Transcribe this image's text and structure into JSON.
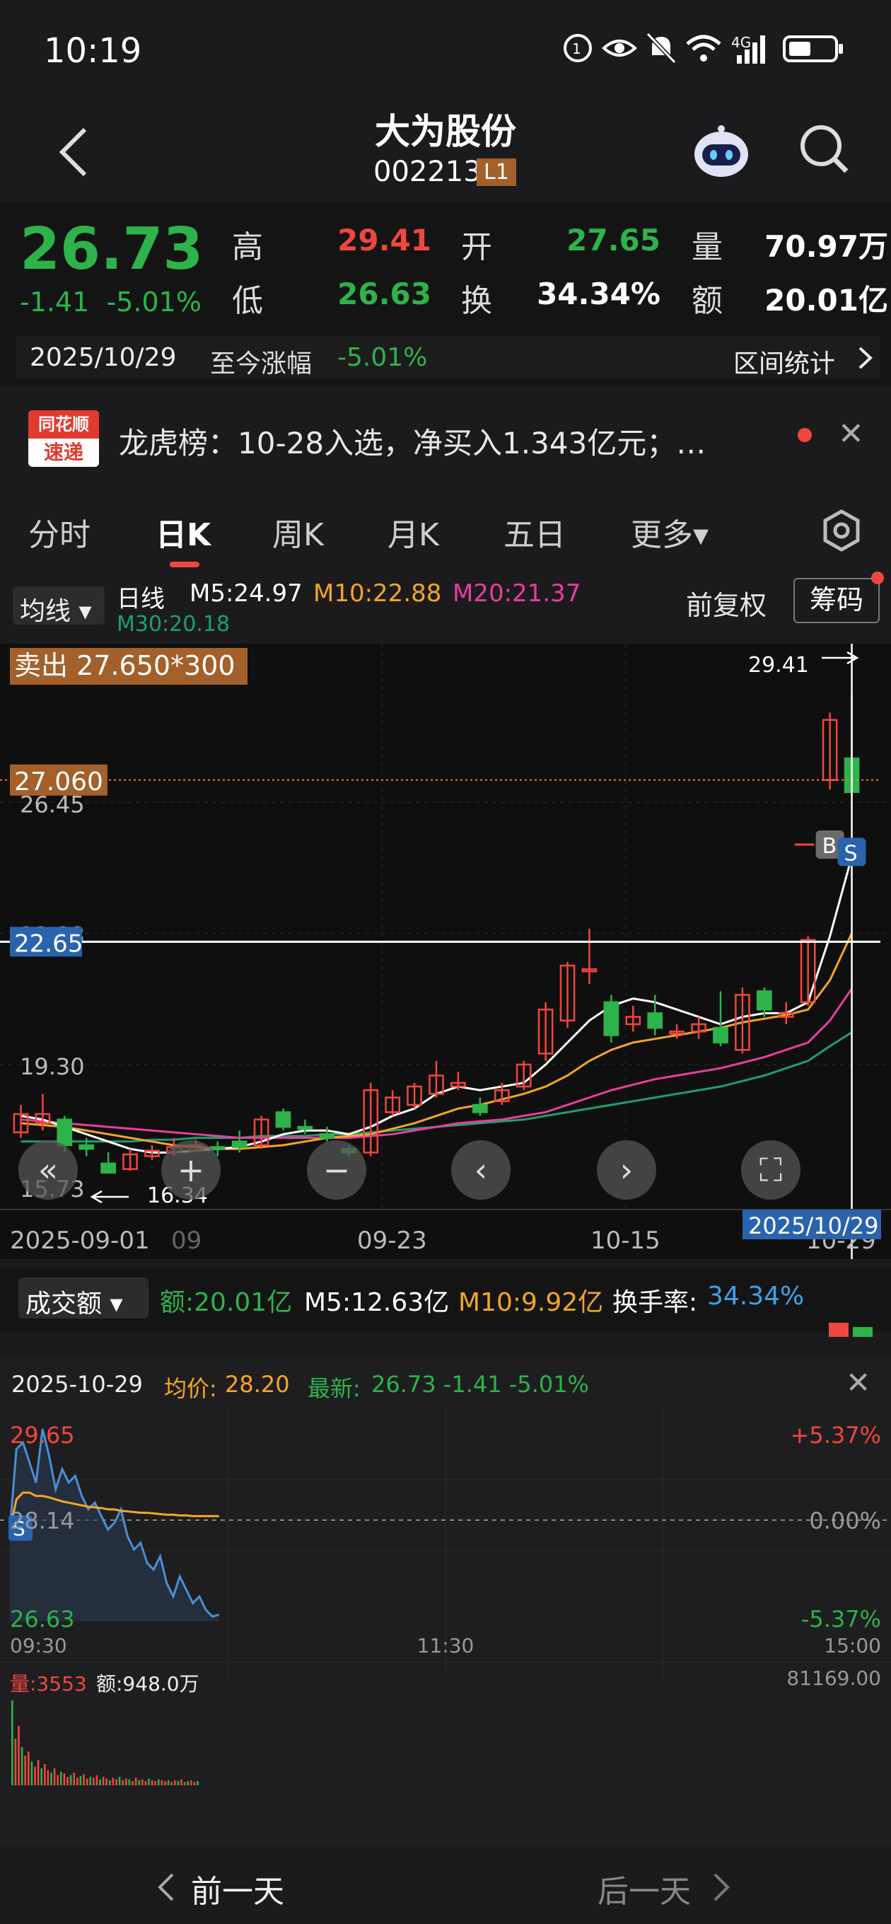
{
  "status": {
    "time": "10:19",
    "network": "4G"
  },
  "header": {
    "title": "大为股份",
    "code": "002213",
    "level": "L1"
  },
  "quote": {
    "price": "26.73",
    "change": "-1.41",
    "change_pct": "-5.01%",
    "high_label": "高",
    "high": "29.41",
    "low_label": "低",
    "low": "26.63",
    "open_label": "开",
    "open": "27.65",
    "turnover_label": "换",
    "turnover": "34.34%",
    "volume_label": "量",
    "volume": "70.97万",
    "amount_label": "额",
    "amount": "20.01亿",
    "date": "2025/10/29",
    "since_label": "至今涨幅",
    "since_value": "-5.01%",
    "stat_label": "区间统计"
  },
  "news": {
    "logo_top": "同花顺",
    "logo_bottom": "速递",
    "text": "龙虎榜：10-28入选，净买入1.343亿元；…",
    "close": "✕"
  },
  "tabs": [
    {
      "label": "分时"
    },
    {
      "label": "日K"
    },
    {
      "label": "周K"
    },
    {
      "label": "月K"
    },
    {
      "label": "五日"
    },
    {
      "label": "更多▾"
    }
  ],
  "ma_row": {
    "selector": "均线 ▾",
    "period": "日线",
    "m5": "M5:24.97",
    "m10": "M10:22.88",
    "m20": "M20:21.37",
    "m30": "M30:20.18",
    "adjust": "前复权",
    "chip": "筹码"
  },
  "kchart": {
    "sell_tag": "卖出 27.650*300",
    "price_tag_1": "27.060",
    "price_tag_2": "22.65",
    "level_1": "26.45",
    "level_2": "22.88",
    "level_3": "19.30",
    "level_4": "15.73",
    "high_mark": "29.41",
    "low_mark": "16.34",
    "x_labels": [
      "2025-09-01",
      "09",
      "09-23",
      "10-15",
      "10-29"
    ],
    "cursor_date": "2025/10/29",
    "b_marker": "B",
    "s_marker": "S",
    "colors": {
      "up": "#f0473d",
      "down": "#2db34a",
      "m5": "#ffffff",
      "m10": "#f5a623",
      "m20": "#e83e9e",
      "m30": "#1f9e6e"
    }
  },
  "chart_data": {
    "type": "candlestick",
    "ylim": [
      15.73,
      30.2
    ],
    "candles": [
      {
        "o": 17.45,
        "c": 17.95,
        "h": 18.2,
        "l": 17.3
      },
      {
        "o": 17.7,
        "c": 17.95,
        "h": 18.5,
        "l": 17.5
      },
      {
        "o": 17.8,
        "c": 17.1,
        "h": 17.9,
        "l": 16.9
      },
      {
        "o": 17.1,
        "c": 17.0,
        "h": 17.3,
        "l": 16.8
      },
      {
        "o": 16.6,
        "c": 16.35,
        "h": 16.9,
        "l": 16.34
      },
      {
        "o": 16.45,
        "c": 16.85,
        "h": 17.0,
        "l": 16.4
      },
      {
        "o": 16.8,
        "c": 16.95,
        "h": 17.1,
        "l": 16.7
      },
      {
        "o": 16.9,
        "c": 17.05,
        "h": 17.3,
        "l": 16.8
      },
      {
        "o": 16.95,
        "c": 17.1,
        "h": 17.25,
        "l": 16.9
      },
      {
        "o": 17.05,
        "c": 17.0,
        "h": 17.2,
        "l": 16.8
      },
      {
        "o": 17.2,
        "c": 17.05,
        "h": 17.5,
        "l": 16.9
      },
      {
        "o": 17.1,
        "c": 17.8,
        "h": 17.9,
        "l": 17.0
      },
      {
        "o": 18.0,
        "c": 17.6,
        "h": 18.1,
        "l": 17.5
      },
      {
        "o": 17.6,
        "c": 17.55,
        "h": 17.8,
        "l": 17.4
      },
      {
        "o": 17.4,
        "c": 17.3,
        "h": 17.6,
        "l": 17.2
      },
      {
        "o": 17.0,
        "c": 16.9,
        "h": 17.1,
        "l": 16.8
      },
      {
        "o": 16.9,
        "c": 18.6,
        "h": 18.8,
        "l": 16.8
      },
      {
        "o": 18.0,
        "c": 18.4,
        "h": 18.6,
        "l": 17.9
      },
      {
        "o": 18.2,
        "c": 18.7,
        "h": 18.8,
        "l": 18.1
      },
      {
        "o": 18.5,
        "c": 19.0,
        "h": 19.4,
        "l": 18.4
      },
      {
        "o": 18.7,
        "c": 18.8,
        "h": 19.1,
        "l": 18.6
      },
      {
        "o": 18.2,
        "c": 18.0,
        "h": 18.4,
        "l": 17.9
      },
      {
        "o": 18.3,
        "c": 18.6,
        "h": 18.8,
        "l": 18.2
      },
      {
        "o": 18.7,
        "c": 19.3,
        "h": 19.4,
        "l": 18.6
      },
      {
        "o": 19.6,
        "c": 20.8,
        "h": 21.0,
        "l": 19.4
      },
      {
        "o": 20.5,
        "c": 22.0,
        "h": 22.1,
        "l": 20.3
      },
      {
        "o": 21.9,
        "c": 21.9,
        "h": 23.0,
        "l": 21.5
      },
      {
        "o": 21.0,
        "c": 20.1,
        "h": 21.2,
        "l": 19.9
      },
      {
        "o": 20.4,
        "c": 20.6,
        "h": 20.9,
        "l": 20.2
      },
      {
        "o": 20.7,
        "c": 20.3,
        "h": 21.2,
        "l": 20.1
      },
      {
        "o": 20.2,
        "c": 20.2,
        "h": 20.4,
        "l": 20.0
      },
      {
        "o": 20.2,
        "c": 20.4,
        "h": 20.6,
        "l": 20.0
      },
      {
        "o": 20.3,
        "c": 19.9,
        "h": 21.3,
        "l": 19.8
      },
      {
        "o": 19.7,
        "c": 21.2,
        "h": 21.4,
        "l": 19.6
      },
      {
        "o": 21.3,
        "c": 20.8,
        "h": 21.4,
        "l": 20.6
      },
      {
        "o": 20.6,
        "c": 20.7,
        "h": 21.0,
        "l": 20.4
      },
      {
        "o": 21.0,
        "c": 22.7,
        "h": 22.8,
        "l": 20.9
      },
      {
        "o": 27.06,
        "c": 28.7,
        "h": 28.9,
        "l": 26.8
      },
      {
        "o": 27.65,
        "c": 26.73,
        "h": 29.41,
        "l": 26.63
      }
    ],
    "ma5": [
      17.9,
      17.8,
      17.6,
      17.4,
      17.2,
      17.0,
      16.9,
      16.9,
      16.95,
      17.0,
      17.05,
      17.2,
      17.4,
      17.5,
      17.5,
      17.4,
      17.6,
      17.9,
      18.1,
      18.5,
      18.7,
      18.6,
      18.7,
      18.8,
      19.3,
      19.9,
      20.5,
      20.9,
      21.1,
      21.0,
      20.8,
      20.6,
      20.4,
      20.6,
      20.7,
      20.7,
      21.0,
      22.8,
      24.97
    ],
    "ma10": [
      17.7,
      17.65,
      17.6,
      17.5,
      17.4,
      17.3,
      17.2,
      17.1,
      17.05,
      17.0,
      17.0,
      17.05,
      17.1,
      17.2,
      17.3,
      17.35,
      17.4,
      17.55,
      17.7,
      17.9,
      18.1,
      18.2,
      18.35,
      18.5,
      18.7,
      19.0,
      19.4,
      19.7,
      19.9,
      20.0,
      20.1,
      20.2,
      20.3,
      20.45,
      20.55,
      20.65,
      20.8,
      21.6,
      22.88
    ],
    "ma20": [
      17.8,
      17.75,
      17.7,
      17.65,
      17.6,
      17.55,
      17.5,
      17.45,
      17.4,
      17.35,
      17.3,
      17.3,
      17.3,
      17.3,
      17.3,
      17.3,
      17.35,
      17.4,
      17.5,
      17.6,
      17.7,
      17.75,
      17.8,
      17.9,
      18.0,
      18.2,
      18.4,
      18.6,
      18.75,
      18.9,
      19.0,
      19.1,
      19.2,
      19.35,
      19.5,
      19.7,
      19.9,
      20.5,
      21.37
    ],
    "ma30": [
      17.2,
      17.2,
      17.2,
      17.2,
      17.2,
      17.2,
      17.25,
      17.25,
      17.3,
      17.3,
      17.3,
      17.35,
      17.35,
      17.35,
      17.4,
      17.4,
      17.45,
      17.5,
      17.55,
      17.6,
      17.65,
      17.7,
      17.75,
      17.8,
      17.9,
      18.0,
      18.1,
      18.2,
      18.3,
      18.4,
      18.5,
      18.6,
      18.7,
      18.85,
      19.0,
      19.2,
      19.4,
      19.8,
      20.18
    ]
  },
  "volume": {
    "selector": "成交额 ▾",
    "amount": "额:20.01亿",
    "m5": "M5:12.63亿",
    "m10": "M10:9.92亿",
    "turnover_label": "换手率:",
    "turnover": "34.34%"
  },
  "intraday": {
    "date": "2025-10-29",
    "avg_label": "均价:",
    "avg": "28.20",
    "latest_label": "最新:",
    "latest": "26.73 -1.41 -5.01%",
    "close": "✕",
    "top_price": "29.65",
    "mid_price": "28.14",
    "bottom_price": "26.63",
    "top_pct": "+5.37%",
    "mid_pct": "0.00%",
    "bottom_pct": "-5.37%",
    "t_start": "09:30",
    "t_mid": "11:30",
    "t_end": "15:00",
    "vol_label": "量:",
    "vol": "3553",
    "amt_label": "额:",
    "amt": "948.0万",
    "vol_max": "81169.00",
    "s_marker": "S",
    "price_series": [
      28.0,
      29.2,
      29.3,
      29.0,
      28.7,
      29.5,
      29.1,
      28.6,
      28.9,
      28.7,
      28.8,
      28.5,
      28.3,
      28.4,
      28.2,
      28.0,
      28.1,
      28.3,
      27.9,
      27.7,
      27.8,
      27.5,
      27.4,
      27.6,
      27.2,
      27.0,
      27.3,
      27.1,
      26.9,
      27.0,
      26.8,
      26.7,
      26.73
    ],
    "avg_series": [
      28.0,
      28.45,
      28.55,
      28.55,
      28.5,
      28.5,
      28.48,
      28.45,
      28.42,
      28.4,
      28.38,
      28.36,
      28.34,
      28.33,
      28.32,
      28.3,
      28.3,
      28.28,
      28.27,
      28.26,
      28.25,
      28.25,
      28.24,
      28.23,
      28.22,
      28.22,
      28.21,
      28.21,
      28.2,
      28.2,
      28.2,
      28.2,
      28.2
    ]
  },
  "footer": {
    "prev": "前一天",
    "next": "后一天"
  }
}
